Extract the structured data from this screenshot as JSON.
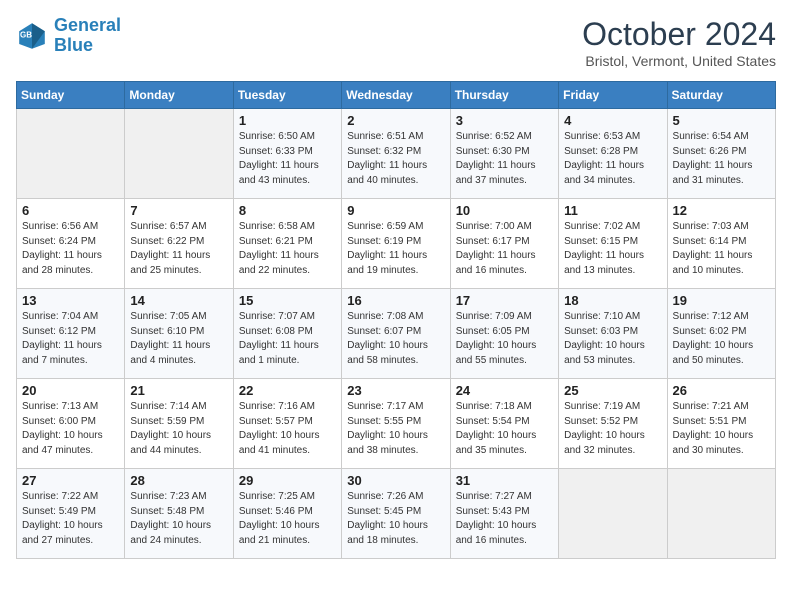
{
  "logo": {
    "line1": "General",
    "line2": "Blue"
  },
  "header": {
    "month": "October 2024",
    "location": "Bristol, Vermont, United States"
  },
  "weekdays": [
    "Sunday",
    "Monday",
    "Tuesday",
    "Wednesday",
    "Thursday",
    "Friday",
    "Saturday"
  ],
  "weeks": [
    [
      {
        "day": "",
        "info": ""
      },
      {
        "day": "",
        "info": ""
      },
      {
        "day": "1",
        "info": "Sunrise: 6:50 AM\nSunset: 6:33 PM\nDaylight: 11 hours and 43 minutes."
      },
      {
        "day": "2",
        "info": "Sunrise: 6:51 AM\nSunset: 6:32 PM\nDaylight: 11 hours and 40 minutes."
      },
      {
        "day": "3",
        "info": "Sunrise: 6:52 AM\nSunset: 6:30 PM\nDaylight: 11 hours and 37 minutes."
      },
      {
        "day": "4",
        "info": "Sunrise: 6:53 AM\nSunset: 6:28 PM\nDaylight: 11 hours and 34 minutes."
      },
      {
        "day": "5",
        "info": "Sunrise: 6:54 AM\nSunset: 6:26 PM\nDaylight: 11 hours and 31 minutes."
      }
    ],
    [
      {
        "day": "6",
        "info": "Sunrise: 6:56 AM\nSunset: 6:24 PM\nDaylight: 11 hours and 28 minutes."
      },
      {
        "day": "7",
        "info": "Sunrise: 6:57 AM\nSunset: 6:22 PM\nDaylight: 11 hours and 25 minutes."
      },
      {
        "day": "8",
        "info": "Sunrise: 6:58 AM\nSunset: 6:21 PM\nDaylight: 11 hours and 22 minutes."
      },
      {
        "day": "9",
        "info": "Sunrise: 6:59 AM\nSunset: 6:19 PM\nDaylight: 11 hours and 19 minutes."
      },
      {
        "day": "10",
        "info": "Sunrise: 7:00 AM\nSunset: 6:17 PM\nDaylight: 11 hours and 16 minutes."
      },
      {
        "day": "11",
        "info": "Sunrise: 7:02 AM\nSunset: 6:15 PM\nDaylight: 11 hours and 13 minutes."
      },
      {
        "day": "12",
        "info": "Sunrise: 7:03 AM\nSunset: 6:14 PM\nDaylight: 11 hours and 10 minutes."
      }
    ],
    [
      {
        "day": "13",
        "info": "Sunrise: 7:04 AM\nSunset: 6:12 PM\nDaylight: 11 hours and 7 minutes."
      },
      {
        "day": "14",
        "info": "Sunrise: 7:05 AM\nSunset: 6:10 PM\nDaylight: 11 hours and 4 minutes."
      },
      {
        "day": "15",
        "info": "Sunrise: 7:07 AM\nSunset: 6:08 PM\nDaylight: 11 hours and 1 minute."
      },
      {
        "day": "16",
        "info": "Sunrise: 7:08 AM\nSunset: 6:07 PM\nDaylight: 10 hours and 58 minutes."
      },
      {
        "day": "17",
        "info": "Sunrise: 7:09 AM\nSunset: 6:05 PM\nDaylight: 10 hours and 55 minutes."
      },
      {
        "day": "18",
        "info": "Sunrise: 7:10 AM\nSunset: 6:03 PM\nDaylight: 10 hours and 53 minutes."
      },
      {
        "day": "19",
        "info": "Sunrise: 7:12 AM\nSunset: 6:02 PM\nDaylight: 10 hours and 50 minutes."
      }
    ],
    [
      {
        "day": "20",
        "info": "Sunrise: 7:13 AM\nSunset: 6:00 PM\nDaylight: 10 hours and 47 minutes."
      },
      {
        "day": "21",
        "info": "Sunrise: 7:14 AM\nSunset: 5:59 PM\nDaylight: 10 hours and 44 minutes."
      },
      {
        "day": "22",
        "info": "Sunrise: 7:16 AM\nSunset: 5:57 PM\nDaylight: 10 hours and 41 minutes."
      },
      {
        "day": "23",
        "info": "Sunrise: 7:17 AM\nSunset: 5:55 PM\nDaylight: 10 hours and 38 minutes."
      },
      {
        "day": "24",
        "info": "Sunrise: 7:18 AM\nSunset: 5:54 PM\nDaylight: 10 hours and 35 minutes."
      },
      {
        "day": "25",
        "info": "Sunrise: 7:19 AM\nSunset: 5:52 PM\nDaylight: 10 hours and 32 minutes."
      },
      {
        "day": "26",
        "info": "Sunrise: 7:21 AM\nSunset: 5:51 PM\nDaylight: 10 hours and 30 minutes."
      }
    ],
    [
      {
        "day": "27",
        "info": "Sunrise: 7:22 AM\nSunset: 5:49 PM\nDaylight: 10 hours and 27 minutes."
      },
      {
        "day": "28",
        "info": "Sunrise: 7:23 AM\nSunset: 5:48 PM\nDaylight: 10 hours and 24 minutes."
      },
      {
        "day": "29",
        "info": "Sunrise: 7:25 AM\nSunset: 5:46 PM\nDaylight: 10 hours and 21 minutes."
      },
      {
        "day": "30",
        "info": "Sunrise: 7:26 AM\nSunset: 5:45 PM\nDaylight: 10 hours and 18 minutes."
      },
      {
        "day": "31",
        "info": "Sunrise: 7:27 AM\nSunset: 5:43 PM\nDaylight: 10 hours and 16 minutes."
      },
      {
        "day": "",
        "info": ""
      },
      {
        "day": "",
        "info": ""
      }
    ]
  ]
}
